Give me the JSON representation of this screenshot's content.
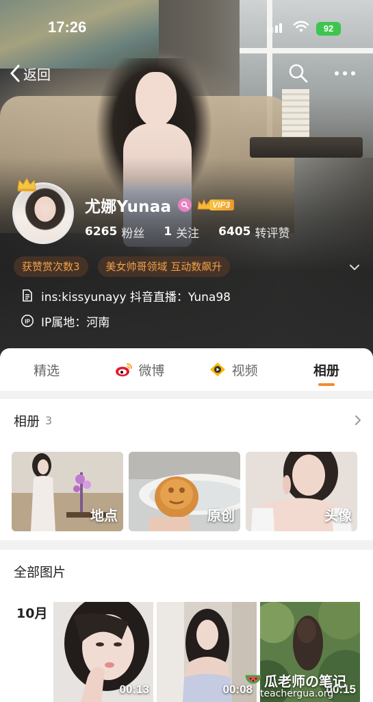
{
  "status_bar": {
    "time": "17:26",
    "battery": "92"
  },
  "nav": {
    "back_label": "返回"
  },
  "profile": {
    "name": "尤娜Yunaa",
    "vip_label": "VIP3",
    "stats": [
      {
        "value": "6265",
        "label": "粉丝"
      },
      {
        "value": "1",
        "label": "关注"
      },
      {
        "value": "6405",
        "label": "转评赞"
      }
    ],
    "tags": [
      "获赞赏次数3",
      "美女帅哥领域 互动数飙升"
    ],
    "bio": "ins:kissyunayy 抖音直播：Yuna98",
    "ip_location": "IP属地：河南"
  },
  "tabs": [
    {
      "label": "精选",
      "active": false
    },
    {
      "label": "微博",
      "active": false
    },
    {
      "label": "视频",
      "active": false
    },
    {
      "label": "相册",
      "active": true
    }
  ],
  "albums_section": {
    "title": "相册",
    "count": "3",
    "items": [
      {
        "label": "地点"
      },
      {
        "label": "原创"
      },
      {
        "label": "头像"
      }
    ]
  },
  "all_photos": {
    "title": "全部图片",
    "month": "10月",
    "items": [
      {
        "duration": "00:13"
      },
      {
        "duration": "00:08"
      },
      {
        "duration": "00:15"
      }
    ]
  },
  "watermark": {
    "line1": "瓜老师の笔记",
    "line2": "teachergua.org"
  },
  "colors": {
    "accent_orange": "#f48b2b",
    "tag_text": "#f3a146",
    "battery_green": "#3ec44f"
  }
}
